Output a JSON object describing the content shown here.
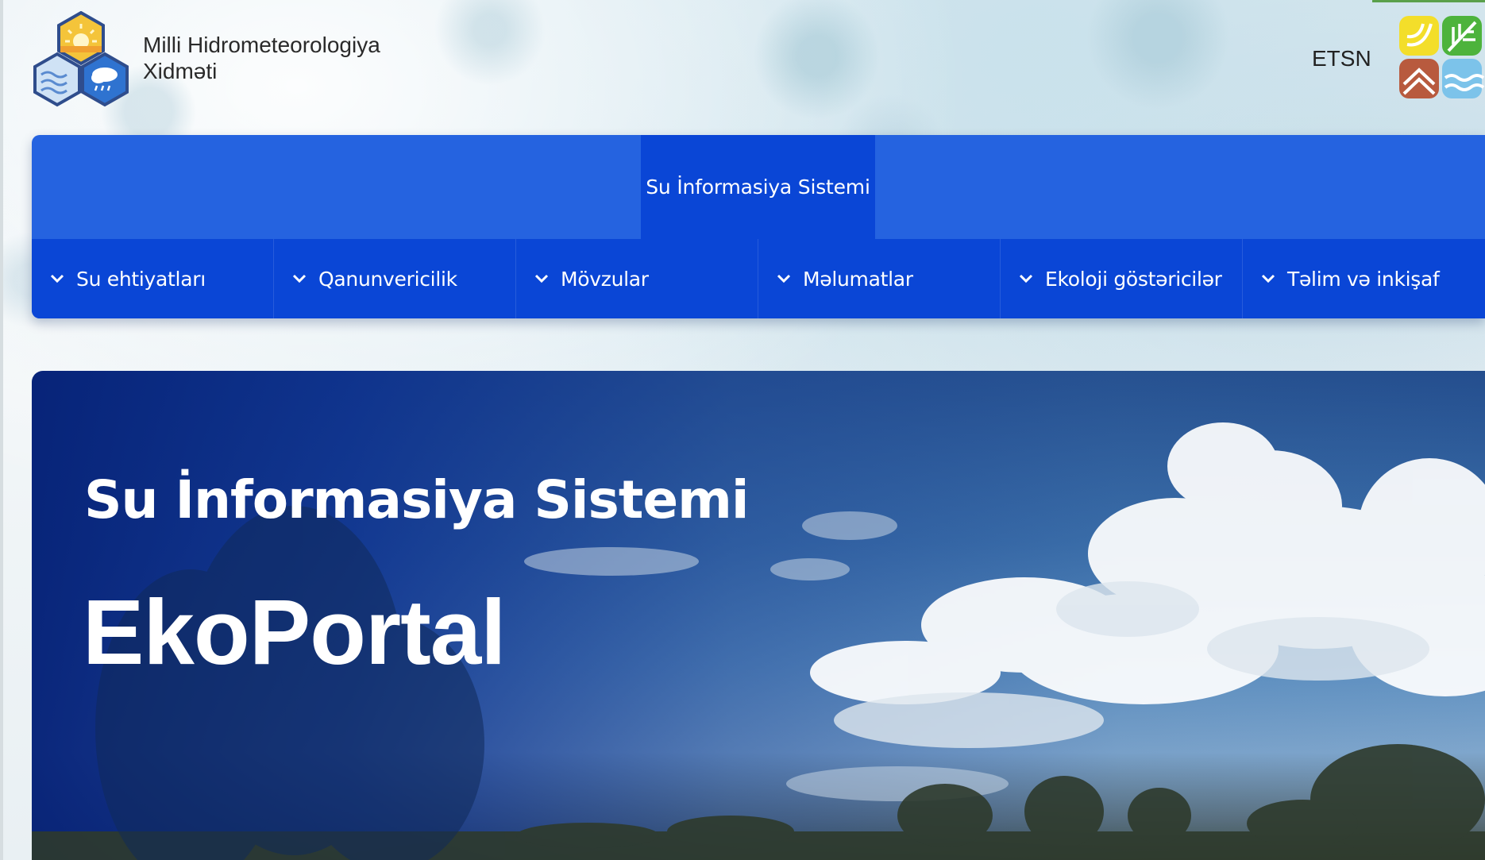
{
  "header": {
    "org_name_line1": "Milli Hidrometeorologiya",
    "org_name_line2": "Xidməti",
    "logo_icon": "hexagon-weather-logo-icon",
    "etsn_label": "ETSN",
    "etsn_logo_icon": "etsn-four-element-logo-icon"
  },
  "nav": {
    "title": "Su İnformasiya Sistemi",
    "menu": [
      {
        "label": "Su ehtiyatları",
        "icon": "chevron-down-icon"
      },
      {
        "label": "Qanunvericilik",
        "icon": "chevron-down-icon"
      },
      {
        "label": "Mövzular",
        "icon": "chevron-down-icon"
      },
      {
        "label": "Məlumatlar",
        "icon": "chevron-down-icon"
      },
      {
        "label": "Ekoloji göstəricilər",
        "icon": "chevron-down-icon"
      },
      {
        "label": "Təlim və inkişaf",
        "icon": "chevron-down-icon"
      }
    ]
  },
  "hero": {
    "subtitle": "Su İnformasiya Sistemi",
    "title": "EkoPortal"
  },
  "colors": {
    "nav_blue": "#2563e0",
    "nav_active": "#0a46d6",
    "hero_overlay": "#062278"
  }
}
